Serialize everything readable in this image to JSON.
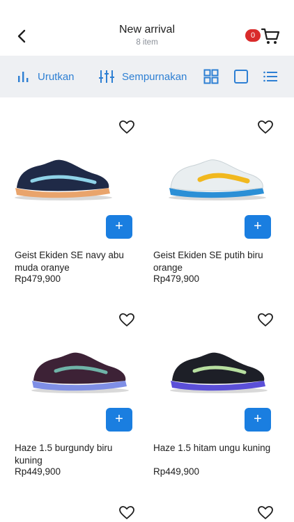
{
  "header": {
    "title": "New arrival",
    "subtitle": "8 item",
    "cart_count": "0"
  },
  "toolbar": {
    "sort_label": "Urutkan",
    "filter_label": "Sempurnakan"
  },
  "colors": {
    "accent": "#2d7fd3",
    "button_blue": "#1a7ee0",
    "badge_red": "#d92b2b",
    "toolbar_bg": "#eef0f3"
  },
  "products": [
    {
      "name": "Geist Ekiden SE navy abu muda oranye",
      "price": "Rp479,900",
      "upper": "#1f2a47",
      "sole": "#e9a46c",
      "stripe": "#8fd3e8"
    },
    {
      "name": "Geist Ekiden SE putih biru orange",
      "price": "Rp479,900",
      "upper": "#e9eef0",
      "sole": "#2b8fd6",
      "stripe": "#f1b81e"
    },
    {
      "name": "Haze 1.5 burgundy biru kuning",
      "price": "Rp449,900",
      "upper": "#3d2236",
      "sole": "#7f8fe6",
      "stripe": "#6fb3a8"
    },
    {
      "name": "Haze 1.5 hitam ungu kuning",
      "price": "Rp449,900",
      "upper": "#1d1f27",
      "sole": "#5b4fd8",
      "stripe": "#b7dfa0"
    }
  ]
}
